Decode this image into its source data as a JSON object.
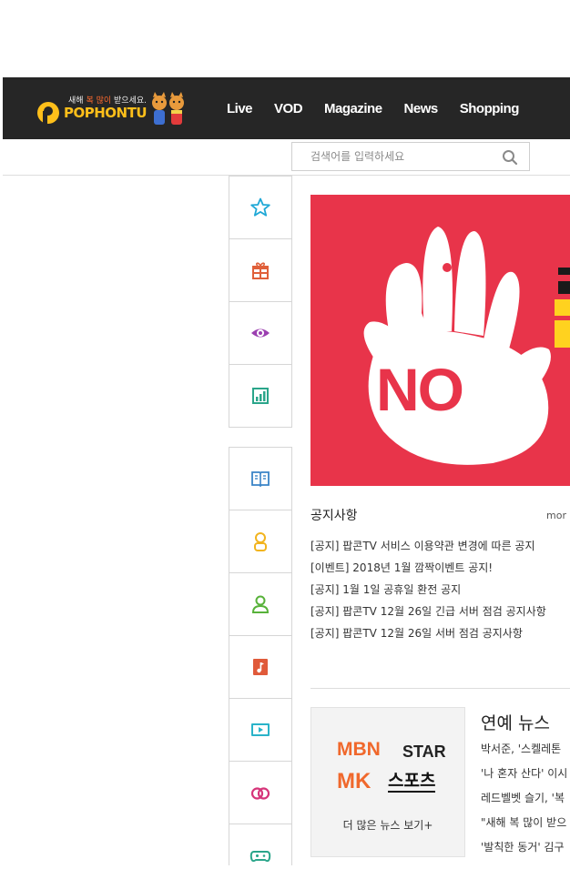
{
  "header": {
    "logo_slogan_pre": "새해",
    "logo_slogan_accent": "복 많이",
    "logo_slogan_post": "받으세요.",
    "logo_brand": "POPHONTU",
    "nav": [
      "Live",
      "VOD",
      "Magazine",
      "News",
      "Shopping"
    ]
  },
  "search": {
    "placeholder": "검색어를 입력하세요"
  },
  "sidebar": {
    "group1": [
      {
        "icon": "star-icon",
        "color": "#1fa8d6"
      },
      {
        "icon": "gift-icon",
        "color": "#e0603a"
      },
      {
        "icon": "eye-icon",
        "color": "#9b3fb0"
      },
      {
        "icon": "chart-icon",
        "color": "#2aa58a"
      }
    ],
    "group2": [
      {
        "icon": "book-icon",
        "color": "#3a84c7"
      },
      {
        "icon": "person-icon",
        "color": "#f2b41e"
      },
      {
        "icon": "person-icon",
        "color": "#58b23a"
      },
      {
        "icon": "music-note-icon",
        "color": "#e05a3a"
      },
      {
        "icon": "film-icon",
        "color": "#2ab3c9"
      },
      {
        "icon": "rings-icon",
        "color": "#d6357a"
      },
      {
        "icon": "gamepad-icon",
        "color": "#2aa58a"
      }
    ]
  },
  "banner": {
    "text": "NO",
    "background": "#e8344a"
  },
  "notice": {
    "title": "공지사항",
    "more": "mor",
    "items": [
      "[공지] 팝콘TV 서비스 이용약관 변경에 따른 공지",
      "[이벤트] 2018년 1월 깜짝이벤트 공지!",
      "[공지] 1월 1일 공휴일 환전 공지",
      "[공지] 팝콘TV 12월 26일 긴급 서버 점검 공지사항",
      "[공지] 팝콘TV 12월 26일 서버 점검 공지사항"
    ]
  },
  "news": {
    "logo_mbn": "MBN",
    "logo_star": "STAR",
    "logo_mk": "MK",
    "logo_sports": "스포츠",
    "more": "더 많은 뉴스 보기+",
    "title": "연예 뉴스",
    "items": [
      "박서준, '스켈레톤",
      "'나 혼자 산다' 이시",
      "레드벨벳 슬기, '복",
      "\"새해 복 많이 받으",
      "'발칙한 동거' 김구"
    ]
  }
}
